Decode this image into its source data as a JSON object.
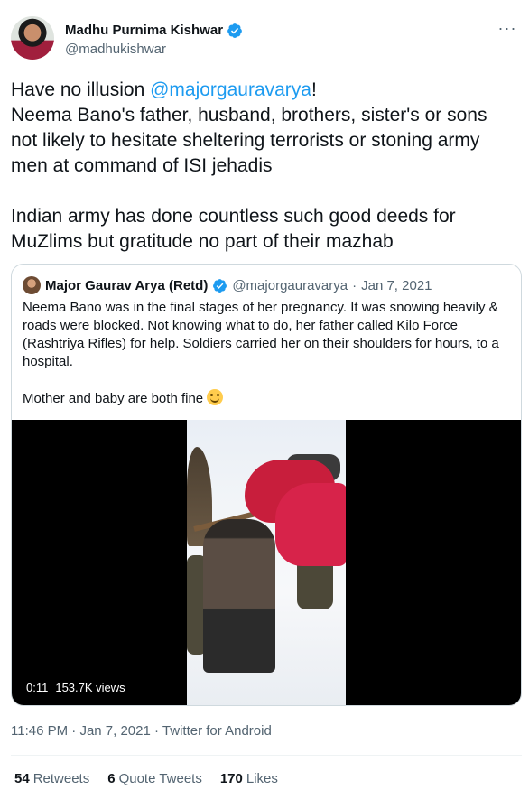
{
  "author": {
    "name": "Madhu Purnima Kishwar",
    "handle": "@madhukishwar",
    "verified": true
  },
  "tweet": {
    "text_before": "Have no illusion ",
    "mention": "@majorgauravarya",
    "text_after": "!\nNeema Bano's father, husband, brothers, sister's or sons not likely to hesitate sheltering terrorists or stoning army men at command of ISI jehadis\n\nIndian army has done countless such good deeds for MuZlims but gratitude no part of their mazhab"
  },
  "quoted": {
    "name": "Major Gaurav Arya (Retd)",
    "handle": "@majorgauravarya",
    "date": "Jan 7, 2021",
    "text": "Neema Bano was in the final stages of her pregnancy. It was snowing heavily & roads were blocked. Not knowing what to do, her father called Kilo Force (Rashtriya Rifles) for help. Soldiers carried her on their shoulders for hours, to a hospital.\n\nMother and baby are both fine ",
    "video": {
      "duration": "0:11",
      "views": "153.7K views"
    }
  },
  "meta": {
    "time": "11:46 PM",
    "date": "Jan 7, 2021",
    "source": "Twitter for Android"
  },
  "stats": {
    "retweets_count": "54",
    "retweets_label": "Retweets",
    "quotes_count": "6",
    "quotes_label": "Quote Tweets",
    "likes_count": "170",
    "likes_label": "Likes"
  },
  "colors": {
    "accent": "#1d9bf0",
    "secondary_text": "#536471",
    "border": "#cfd9de"
  }
}
